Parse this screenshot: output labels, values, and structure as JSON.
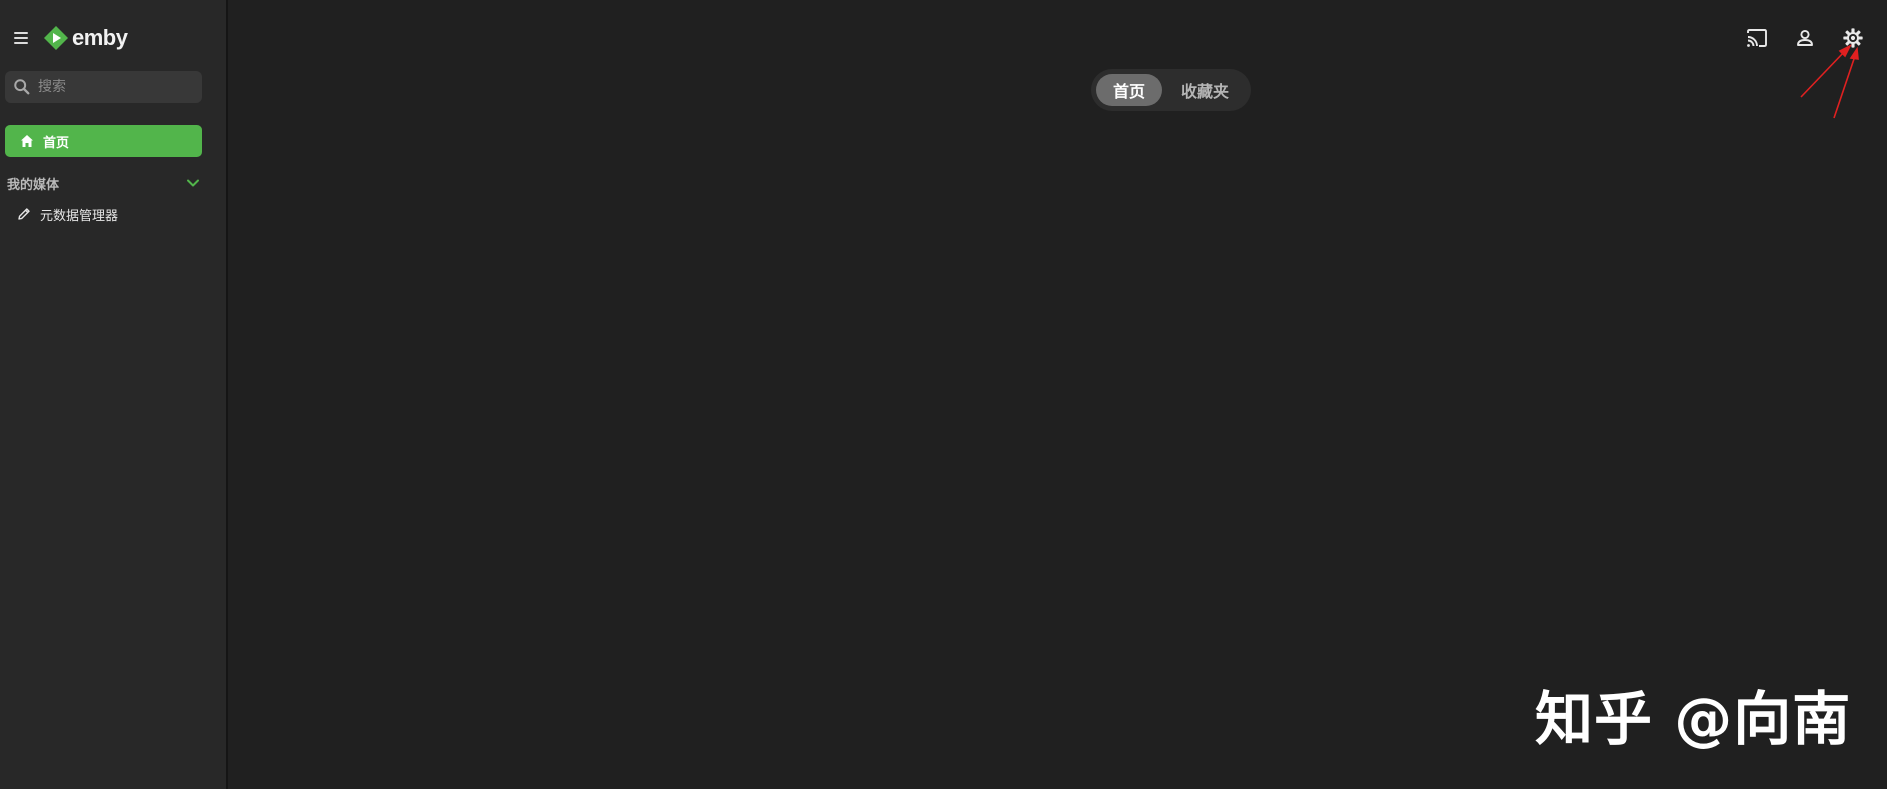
{
  "app": {
    "name": "emby",
    "brand_color": "#52b54b",
    "background": "#202020",
    "sidebar_background": "#282828"
  },
  "sidebar": {
    "search": {
      "placeholder": "搜索",
      "value": ""
    },
    "home": {
      "label": "首页",
      "icon": "home-icon"
    },
    "section": {
      "label": "我的媒体",
      "icon": "chevron-down-icon"
    },
    "items": [
      {
        "label": "元数据管理器",
        "icon": "edit-icon"
      }
    ]
  },
  "header": {
    "tabs": [
      {
        "label": "首页",
        "active": true
      },
      {
        "label": "收藏夹",
        "active": false
      }
    ],
    "actions": [
      {
        "name": "cast",
        "icon": "cast-icon"
      },
      {
        "name": "user",
        "icon": "user-icon"
      },
      {
        "name": "settings",
        "icon": "gear-icon"
      }
    ]
  },
  "annotation": {
    "color": "#e02020",
    "target": "settings"
  },
  "watermark": {
    "text": "知乎 @向南"
  }
}
